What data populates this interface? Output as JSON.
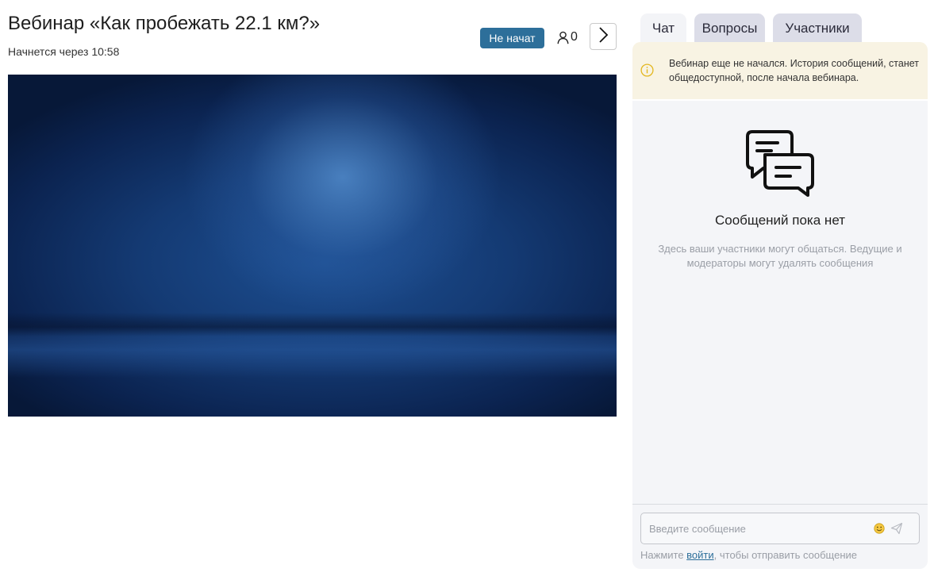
{
  "webinar": {
    "title": "Вебинар «Как пробежать 22.1 км?»",
    "subtitle": "Начнется через 10:58",
    "status_label": "Не начат",
    "participants_count": "0"
  },
  "icons": {
    "participants": "person-icon",
    "next": "chevron-right-icon",
    "notice": "info-icon",
    "empty": "chat-bubbles-icon",
    "emoji": "smiley-icon",
    "send": "paper-plane-icon"
  },
  "tabs": [
    {
      "label": "Чат",
      "active": true
    },
    {
      "label": "Вопросы",
      "active": false
    },
    {
      "label": "Участники",
      "active": false
    }
  ],
  "chat": {
    "notice": "Вебинар еще не начался. История сообщений, станет общедоступной, после начала вебинара.",
    "empty_title": "Сообщений пока нет",
    "empty_description": "Здесь ваши участники могут общаться. Ведущие и модераторы могут удалять сообщения",
    "input_placeholder": "Введите сообщение",
    "login_prefix": "Нажмите ",
    "login_link": "войти",
    "login_suffix": ", чтобы отправить сообщение"
  },
  "colors": {
    "status_badge": "#2d6f9a",
    "notice_background": "#f8f3e3",
    "notice_icon": "#e3b71f",
    "chat_panel_background": "#f4f5f8",
    "inactive_tab": "#dcdde8"
  }
}
